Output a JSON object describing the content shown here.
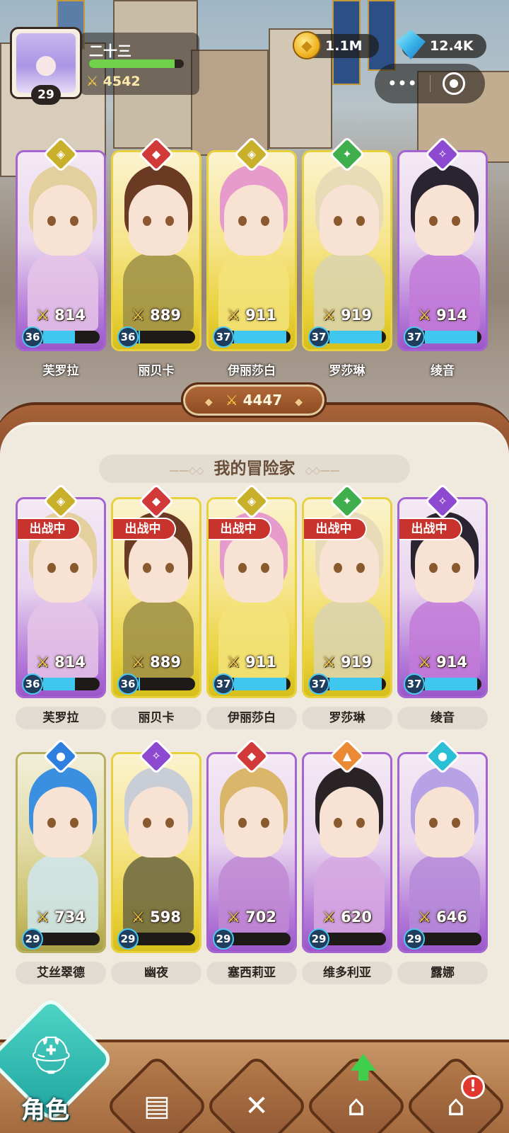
{
  "player": {
    "name": "二十三",
    "level": "29",
    "power": "4542",
    "xp_fraction": 0.9
  },
  "currencies": {
    "gold": "1.1M",
    "gems": "12.4K"
  },
  "team": {
    "power": "4447",
    "heroes": [
      {
        "name": "芙罗拉",
        "power": "814",
        "level": "36",
        "element": "gold",
        "frame": "purple",
        "level_fraction": 0.55
      },
      {
        "name": "丽贝卡",
        "power": "889",
        "level": "36",
        "element": "red",
        "frame": "gold",
        "level_fraction": 0.02
      },
      {
        "name": "伊丽莎白",
        "power": "911",
        "level": "37",
        "element": "gold",
        "frame": "gold",
        "level_fraction": 0.9
      },
      {
        "name": "罗莎琳",
        "power": "919",
        "level": "37",
        "element": "green",
        "frame": "gold",
        "level_fraction": 0.9
      },
      {
        "name": "绫音",
        "power": "914",
        "level": "37",
        "element": "purple",
        "frame": "purple",
        "level_fraction": 0.9
      }
    ]
  },
  "roster": {
    "title": "我的冒险家",
    "in_battle_label": "出战中",
    "heroes": [
      {
        "name": "芙罗拉",
        "power": "814",
        "level": "36",
        "element": "gold",
        "frame": "purple",
        "level_fraction": 0.55,
        "in_battle": true
      },
      {
        "name": "丽贝卡",
        "power": "889",
        "level": "36",
        "element": "red",
        "frame": "gold",
        "level_fraction": 0.02,
        "in_battle": true
      },
      {
        "name": "伊丽莎白",
        "power": "911",
        "level": "37",
        "element": "gold",
        "frame": "gold",
        "level_fraction": 0.9,
        "in_battle": true
      },
      {
        "name": "罗莎琳",
        "power": "919",
        "level": "37",
        "element": "green",
        "frame": "gold",
        "level_fraction": 0.9,
        "in_battle": true
      },
      {
        "name": "绫音",
        "power": "914",
        "level": "37",
        "element": "purple",
        "frame": "purple",
        "level_fraction": 0.9,
        "in_battle": true
      },
      {
        "name": "艾丝翠德",
        "power": "734",
        "level": "29",
        "element": "blue",
        "frame": "olive",
        "level_fraction": 0.0,
        "in_battle": false
      },
      {
        "name": "幽夜",
        "power": "598",
        "level": "29",
        "element": "purple",
        "frame": "gold",
        "level_fraction": 0.0,
        "in_battle": false
      },
      {
        "name": "塞西莉亚",
        "power": "702",
        "level": "29",
        "element": "red",
        "frame": "purple",
        "level_fraction": 0.0,
        "in_battle": false
      },
      {
        "name": "维多利亚",
        "power": "620",
        "level": "29",
        "element": "orange",
        "frame": "purple",
        "level_fraction": 0.0,
        "in_battle": false
      },
      {
        "name": "露娜",
        "power": "646",
        "level": "29",
        "element": "cyan",
        "frame": "purple",
        "level_fraction": 0.0,
        "in_battle": false
      }
    ]
  },
  "nav": {
    "active_label": "角色",
    "alert": "!",
    "items": [
      {
        "icon": "helmet-icon"
      },
      {
        "icon": "book-icon"
      },
      {
        "icon": "crossed-swords-icon"
      },
      {
        "icon": "castle-icon"
      },
      {
        "icon": "shop-icon"
      }
    ]
  },
  "colors": {
    "frame_purple": "#a562d1",
    "frame_gold": "#e8d13d",
    "level_bar": "#3fc7ef",
    "xp_bar": "#6fd24a",
    "in_battle": "#c8342d",
    "nav_active": "#1fa3a1"
  }
}
